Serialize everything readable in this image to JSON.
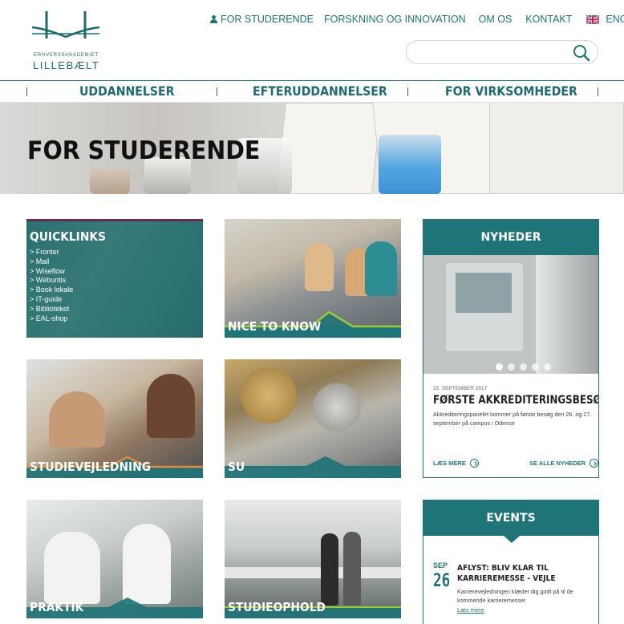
{
  "logo": {
    "line1": "ERHVERVSAKADEMIET",
    "line2": "LILLEBÆLT"
  },
  "topnav": {
    "for_students": "FOR STUDERENDE",
    "research": "FORSKNING OG INNOVATION",
    "about": "OM OS",
    "contact": "KONTAKT",
    "english": "ENGLISH"
  },
  "search": {
    "placeholder": "",
    "icon": "search-icon"
  },
  "mainnav": [
    "UDDANNELSER",
    "EFTERUDDANNELSER",
    "FOR VIRKSOMHEDER"
  ],
  "hero": {
    "title": "FOR STUDERENDE"
  },
  "quicklinks": {
    "title": "QUICKLINKS",
    "items": [
      "> Fronter",
      "> Mail",
      "> Wiseflow",
      "> Webuntis",
      "> Book lokale",
      "> IT-guide",
      "> Biblioteket",
      "> EAL-shop"
    ]
  },
  "tiles": {
    "nice_to_know": "NICE TO KNOW",
    "studievejledning": "STUDIEVEJLEDNING",
    "su": "SU",
    "praktik": "PRAKTIK",
    "studieophold": "STUDIEOPHOLD"
  },
  "news": {
    "heading": "NYHEDER",
    "date": "25. SEPTEMBER 2017",
    "title": "FØRSTE AKKREDITERINGSBESØG",
    "text": "Akkrediteringspanelet kommer på første besøg den 26. og 27. september på campus i Odense",
    "read_more": "LÆS MERE",
    "see_all": "SE ALLE NYHEDER",
    "slides_total": 5,
    "slide_active": 1
  },
  "events": {
    "heading": "EVENTS",
    "month": "SEP",
    "day": "26",
    "title": "AFLYST: BLIV KLAR TIL KARRIEREMESSE - VEJLE",
    "text": "Karrierevejledningen klæder dig godt på til de kommende karrieremesser",
    "link": "Læs mere"
  },
  "colors": {
    "brand": "#1f7478",
    "accent_purple": "#6b2a55",
    "accent_green": "#9acd32",
    "accent_orange": "#e8893a"
  }
}
